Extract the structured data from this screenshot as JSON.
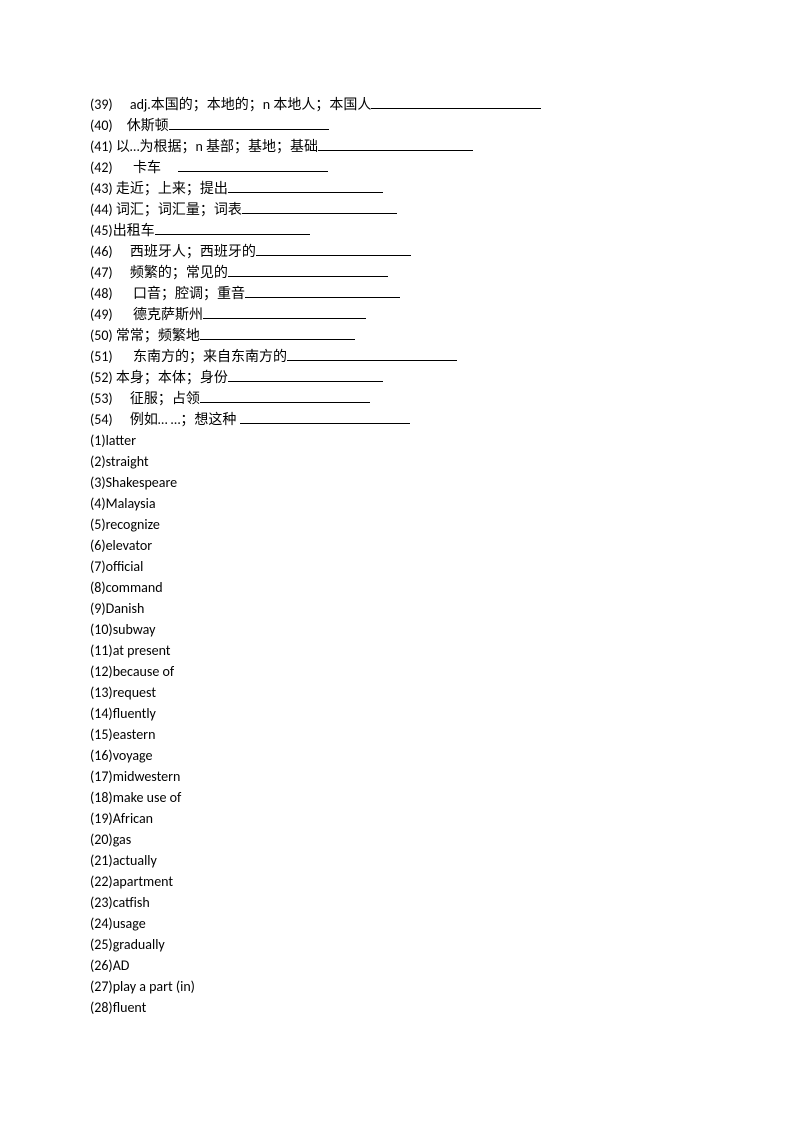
{
  "questions": [
    {
      "num": "(39)",
      "pre": "　 ",
      "text": "adj.本国的；本地的；n 本地人；本国人",
      "blank": 170
    },
    {
      "num": "(40)",
      "pre": "　",
      "text": "休斯顿",
      "blank": 160
    },
    {
      "num": "(41)",
      "pre": " ",
      "text": "以…为根据；n 基部；基地；基础",
      "blank": 155
    },
    {
      "num": "(42)",
      "pre": "　  ",
      "text": "卡车　 ",
      "blank": 150
    },
    {
      "num": "(43)",
      "pre": "",
      "text": " 走近；上来；提出",
      "blank": 155
    },
    {
      "num": "(44)",
      "pre": "",
      "text": " 词汇；词汇量；词表",
      "blank": 155
    },
    {
      "num": "(45)",
      "pre": "",
      "text": "出租车",
      "blank": 155
    },
    {
      "num": "(46)",
      "pre": " 　",
      "text": "西班牙人；西班牙的",
      "blank": 155
    },
    {
      "num": "(47)",
      "pre": " 　",
      "text": "频繁的；常见的",
      "blank": 160
    },
    {
      "num": "(48)",
      "pre": " 　 ",
      "text": "口音；腔调；重音",
      "blank": 155
    },
    {
      "num": "(49)",
      "pre": " 　 ",
      "text": "德克萨斯州",
      "blank": 163
    },
    {
      "num": "(50)",
      "pre": "",
      "text": " 常常；频繁地",
      "blank": 155
    },
    {
      "num": "(51)",
      "pre": "　  ",
      "text": "东南方的；来自东南方的",
      "blank": 170
    },
    {
      "num": "(52)",
      "pre": "",
      "text": " 本身；本体；身份",
      "blank": 155
    },
    {
      "num": "(53)",
      "pre": " 　",
      "text": "征服；占领",
      "blank": 170
    },
    {
      "num": "(54)",
      "pre": " 　",
      "text": "例如… …；想这种 ",
      "blank": 170
    }
  ],
  "answers": [
    {
      "num": "(1)",
      "text": "latter"
    },
    {
      "num": "(2)",
      "text": "straight"
    },
    {
      "num": "(3)",
      "text": "Shakespeare"
    },
    {
      "num": "(4)",
      "text": "Malaysia"
    },
    {
      "num": "(5)",
      "text": "recognize"
    },
    {
      "num": "(6)",
      "text": "elevator"
    },
    {
      "num": "(7)",
      "text": "official"
    },
    {
      "num": "(8)",
      "text": "command"
    },
    {
      "num": "(9)",
      "text": "Danish"
    },
    {
      "num": "(10)",
      "text": "subway"
    },
    {
      "num": "(11)",
      "text": "at present"
    },
    {
      "num": "(12)",
      "text": "because of"
    },
    {
      "num": "(13)",
      "text": "request"
    },
    {
      "num": "(14)",
      "text": "fluently"
    },
    {
      "num": "(15)",
      "text": "eastern"
    },
    {
      "num": "(16)",
      "text": "voyage"
    },
    {
      "num": "(17)",
      "text": "midwestern"
    },
    {
      "num": "(18)",
      "text": "make use of"
    },
    {
      "num": "(19)",
      "text": "African"
    },
    {
      "num": "(20)",
      "text": "gas"
    },
    {
      "num": "(21)",
      "text": "actually"
    },
    {
      "num": "(22)",
      "text": "apartment"
    },
    {
      "num": "(23)",
      "text": "catfish"
    },
    {
      "num": "(24)",
      "text": "usage"
    },
    {
      "num": "(25)",
      "text": "gradually"
    },
    {
      "num": "(26)",
      "text": "AD"
    },
    {
      "num": "(27)",
      "text": "play a part (in)"
    },
    {
      "num": "(28)",
      "text": "fluent"
    }
  ]
}
